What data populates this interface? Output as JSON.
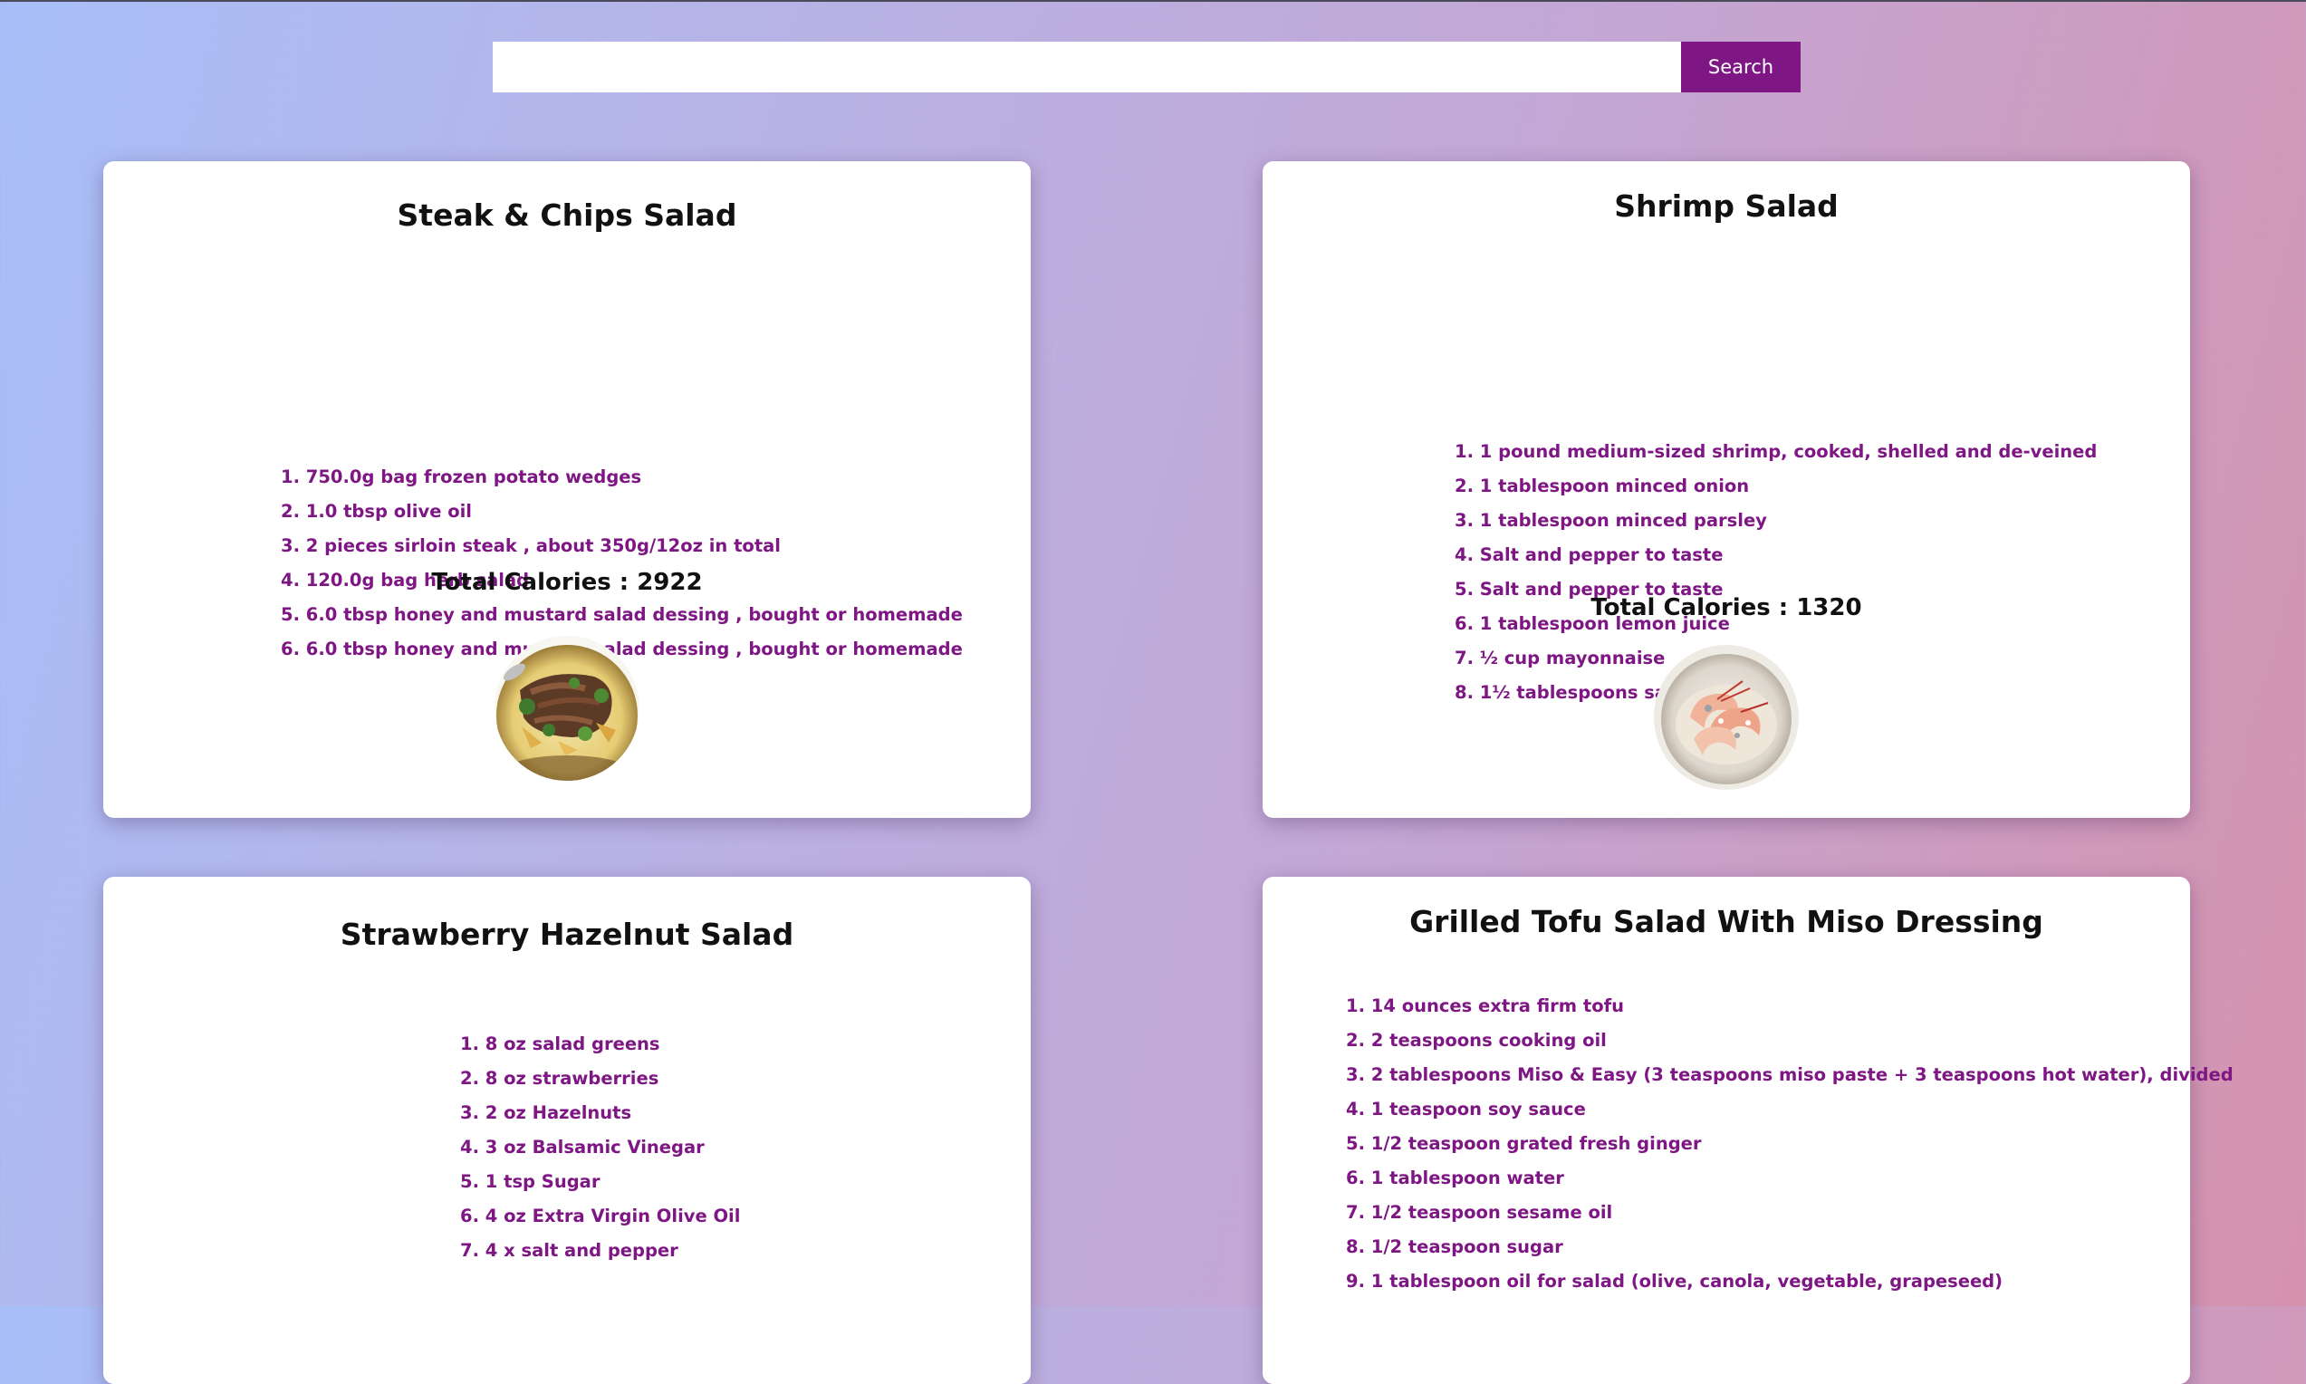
{
  "search": {
    "value": "",
    "placeholder": "",
    "button_label": "Search"
  },
  "labels": {
    "total_calories": "Total Calories : "
  },
  "recipes": [
    {
      "title": "Steak & Chips Salad",
      "ingredients": [
        "1. 750.0g bag frozen potato wedges",
        "2. 1.0 tbsp olive oil",
        "3. 2 pieces sirloin steak , about 350g/12oz in total",
        "4. 120.0g bag herb salad",
        "5. 6.0 tbsp honey and mustard salad dessing , bought or homemade",
        "6. 6.0 tbsp honey and mustard salad dessing , bought or homemade"
      ],
      "total_calories": "2922",
      "photo_icon": "steak-salad-photo"
    },
    {
      "title": "Shrimp Salad",
      "ingredients": [
        "1. 1 pound medium-sized shrimp, cooked, shelled and de-veined",
        "2. 1 tablespoon minced onion",
        "3. 1 tablespoon minced parsley",
        "4. Salt and pepper to taste",
        "5. Salt and pepper to taste",
        "6. 1 tablespoon lemon juice",
        "7. ½ cup mayonnaise",
        "8. 1½ tablespoons salad oil"
      ],
      "total_calories": "1320",
      "photo_icon": "shrimp-salad-photo"
    },
    {
      "title": "Strawberry Hazelnut Salad",
      "ingredients": [
        "1. 8 oz salad greens",
        "2. 8 oz strawberries",
        "3. 2 oz Hazelnuts",
        "4. 3 oz Balsamic Vinegar",
        "5. 1 tsp Sugar",
        "6. 4 oz Extra Virgin Olive Oil",
        "7. 4 x salt and pepper"
      ]
    },
    {
      "title": "Grilled Tofu Salad With Miso Dressing",
      "ingredients": [
        "1. 14 ounces extra firm tofu",
        "2. 2 teaspoons cooking oil",
        "3. 2 tablespoons Miso & Easy (3 teaspoons miso paste + 3 teaspoons hot water), divided",
        "4. 1 teaspoon soy sauce",
        "5. 1/2 teaspoon grated fresh ginger",
        "6. 1 tablespoon water",
        "7. 1/2 teaspoon sesame oil",
        "8. 1/2 teaspoon sugar",
        "9. 1 tablespoon oil for salad (olive, canola, vegetable, grapeseed)"
      ]
    }
  ],
  "colors": {
    "accent": "#7e1684",
    "card_bg": "#ffffff",
    "title_text": "#111111"
  }
}
